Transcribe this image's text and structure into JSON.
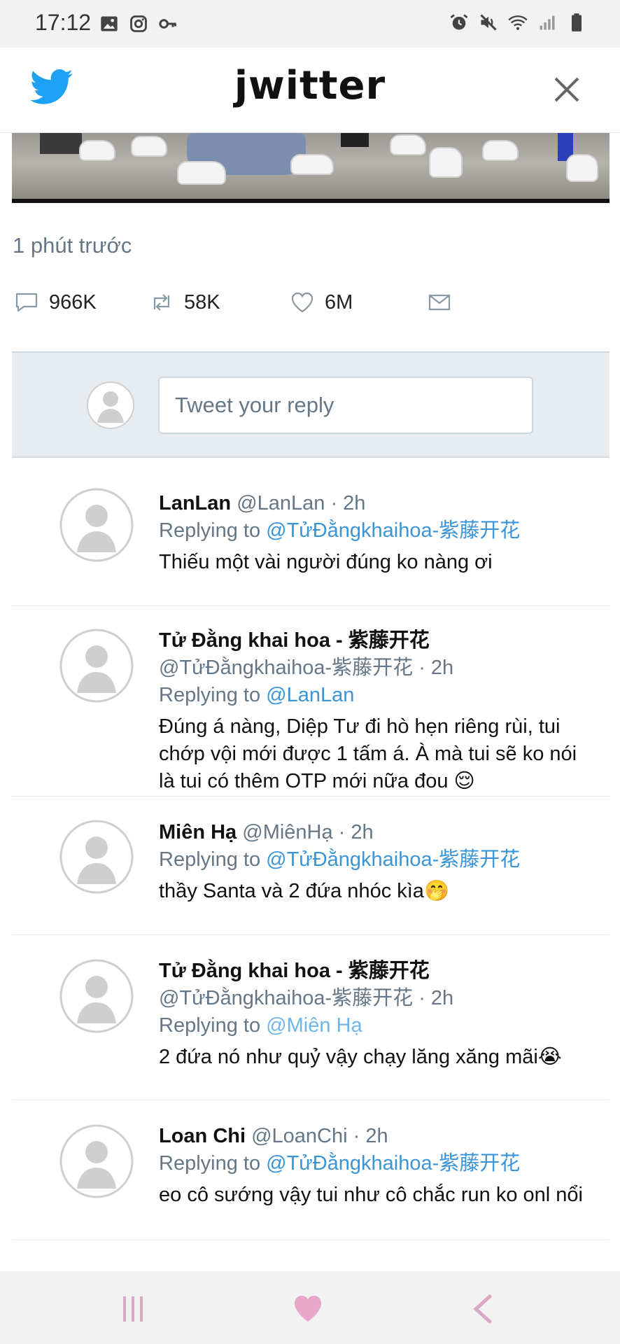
{
  "status_bar": {
    "time": "17:12",
    "left_icons": [
      "image-icon",
      "instagram-icon",
      "key-icon"
    ],
    "right_icons": [
      "alarm-icon",
      "mute-icon",
      "wifi-icon",
      "signal-icon",
      "battery-icon"
    ]
  },
  "header": {
    "logo_text": "jwitter",
    "brand_color": "#1da1f2"
  },
  "tweet": {
    "timestamp": "1 phút trước",
    "comments": "966K",
    "retweets": "58K",
    "likes": "6M"
  },
  "reply_box": {
    "placeholder": "Tweet your reply"
  },
  "replies": [
    {
      "name": "LanLan",
      "handle": "@LanLan · 2h",
      "replying_label": "Replying to",
      "replying_to": "@TửĐằngkhaihoa-紫藤开花",
      "text": "Thiếu một vài người đúng ko nàng ơi"
    },
    {
      "name": "Tử Đằng khai hoa - 紫藤开花",
      "handle": "@TửĐằngkhaihoa-紫藤开花 · 2h",
      "replying_label": "Replying to",
      "replying_to": "@LanLan",
      "text": "Đúng á nàng, Diệp Tư đi hò hẹn riêng rùi, tui chớp vội mới được 1 tấm á. À mà tui sẽ ko nói là tui có thêm OTP mới nữa đou 😌"
    },
    {
      "name": "Miên Hạ",
      "handle": "@MiênHạ · 2h",
      "replying_label": "Replying to",
      "replying_to": "@TửĐằngkhaihoa-紫藤开花",
      "text": "thầy Santa và 2 đứa nhóc kìa🤭"
    },
    {
      "name": "Tử Đằng khai hoa - 紫藤开花",
      "handle": "@TửĐằngkhaihoa-紫藤开花 · 2h",
      "replying_label": "Replying to",
      "replying_to": "@Miên Hạ",
      "text": "2 đứa nó như quỷ vậy chạy lăng xăng mãi😭"
    },
    {
      "name": "Loan Chi",
      "handle": "@LoanChi · 2h",
      "replying_label": "Replying to",
      "replying_to": "@TửĐằngkhaihoa-紫藤开花",
      "text": "eo cô sướng vậy tui như cô chắc run ko onl nổi"
    }
  ],
  "nav_bar": {
    "buttons": [
      "recent-apps-icon",
      "home-heart-icon",
      "back-icon"
    ]
  }
}
